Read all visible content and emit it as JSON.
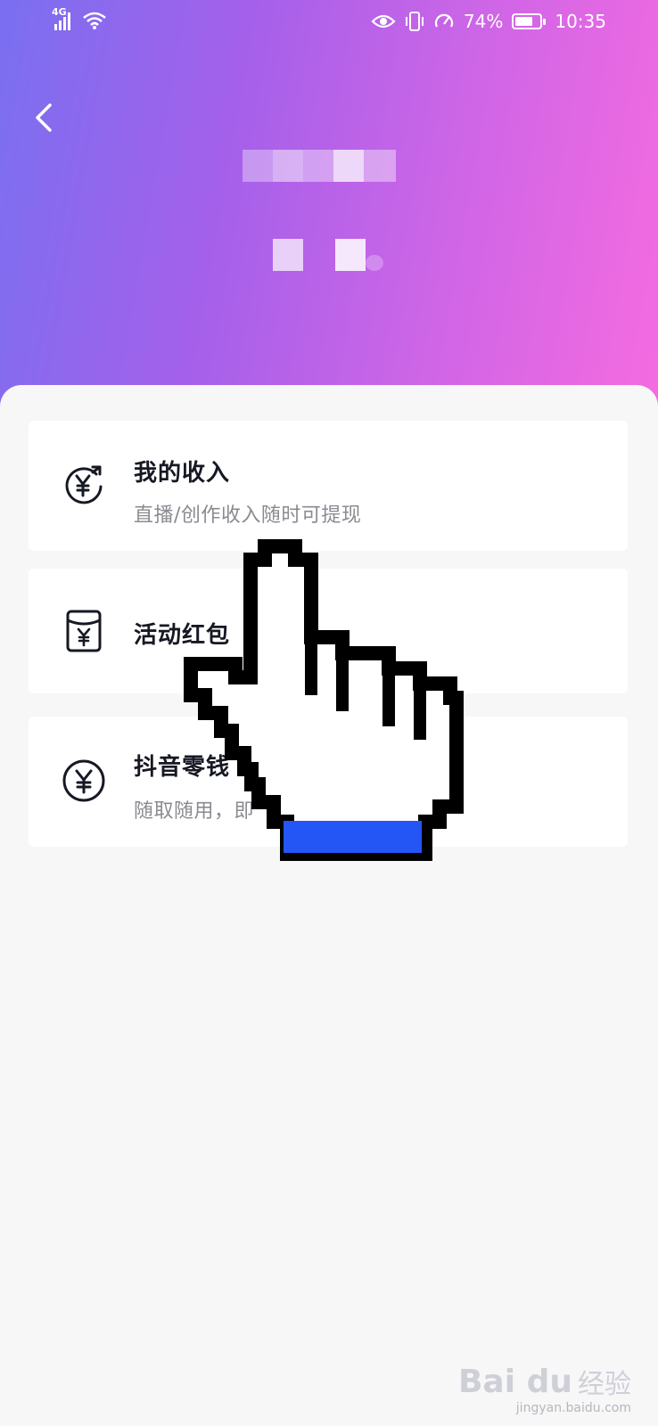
{
  "status_bar": {
    "network": "4G",
    "battery_percent": "74%",
    "battery_level": 0.74,
    "time": "10:35",
    "icons": [
      "signal-icon",
      "wifi-icon",
      "eye-icon",
      "vibrate-icon",
      "speed-icon",
      "battery-icon"
    ]
  },
  "header": {
    "back_icon": "chevron-left-icon",
    "gradient": [
      "#7a6ff0",
      "#a560ea",
      "#d266e6",
      "#f56be0"
    ]
  },
  "cards": [
    {
      "title": "我的收入",
      "subtitle": "直播/创作收入随时可提现",
      "icon": "yuan-withdraw-icon"
    },
    {
      "title": "活动红包",
      "subtitle": "",
      "icon": "red-envelope-icon"
    },
    {
      "title": "抖音零钱",
      "subtitle": "随取随用，即",
      "icon": "yuan-circle-icon"
    }
  ],
  "overlay": {
    "cursor": "pointing-hand-cursor-icon",
    "cursor_cuff_color": "#2456f5"
  },
  "watermark": {
    "logo": "Bai du",
    "brand": "经验",
    "url": "jingyan.baidu.com"
  }
}
